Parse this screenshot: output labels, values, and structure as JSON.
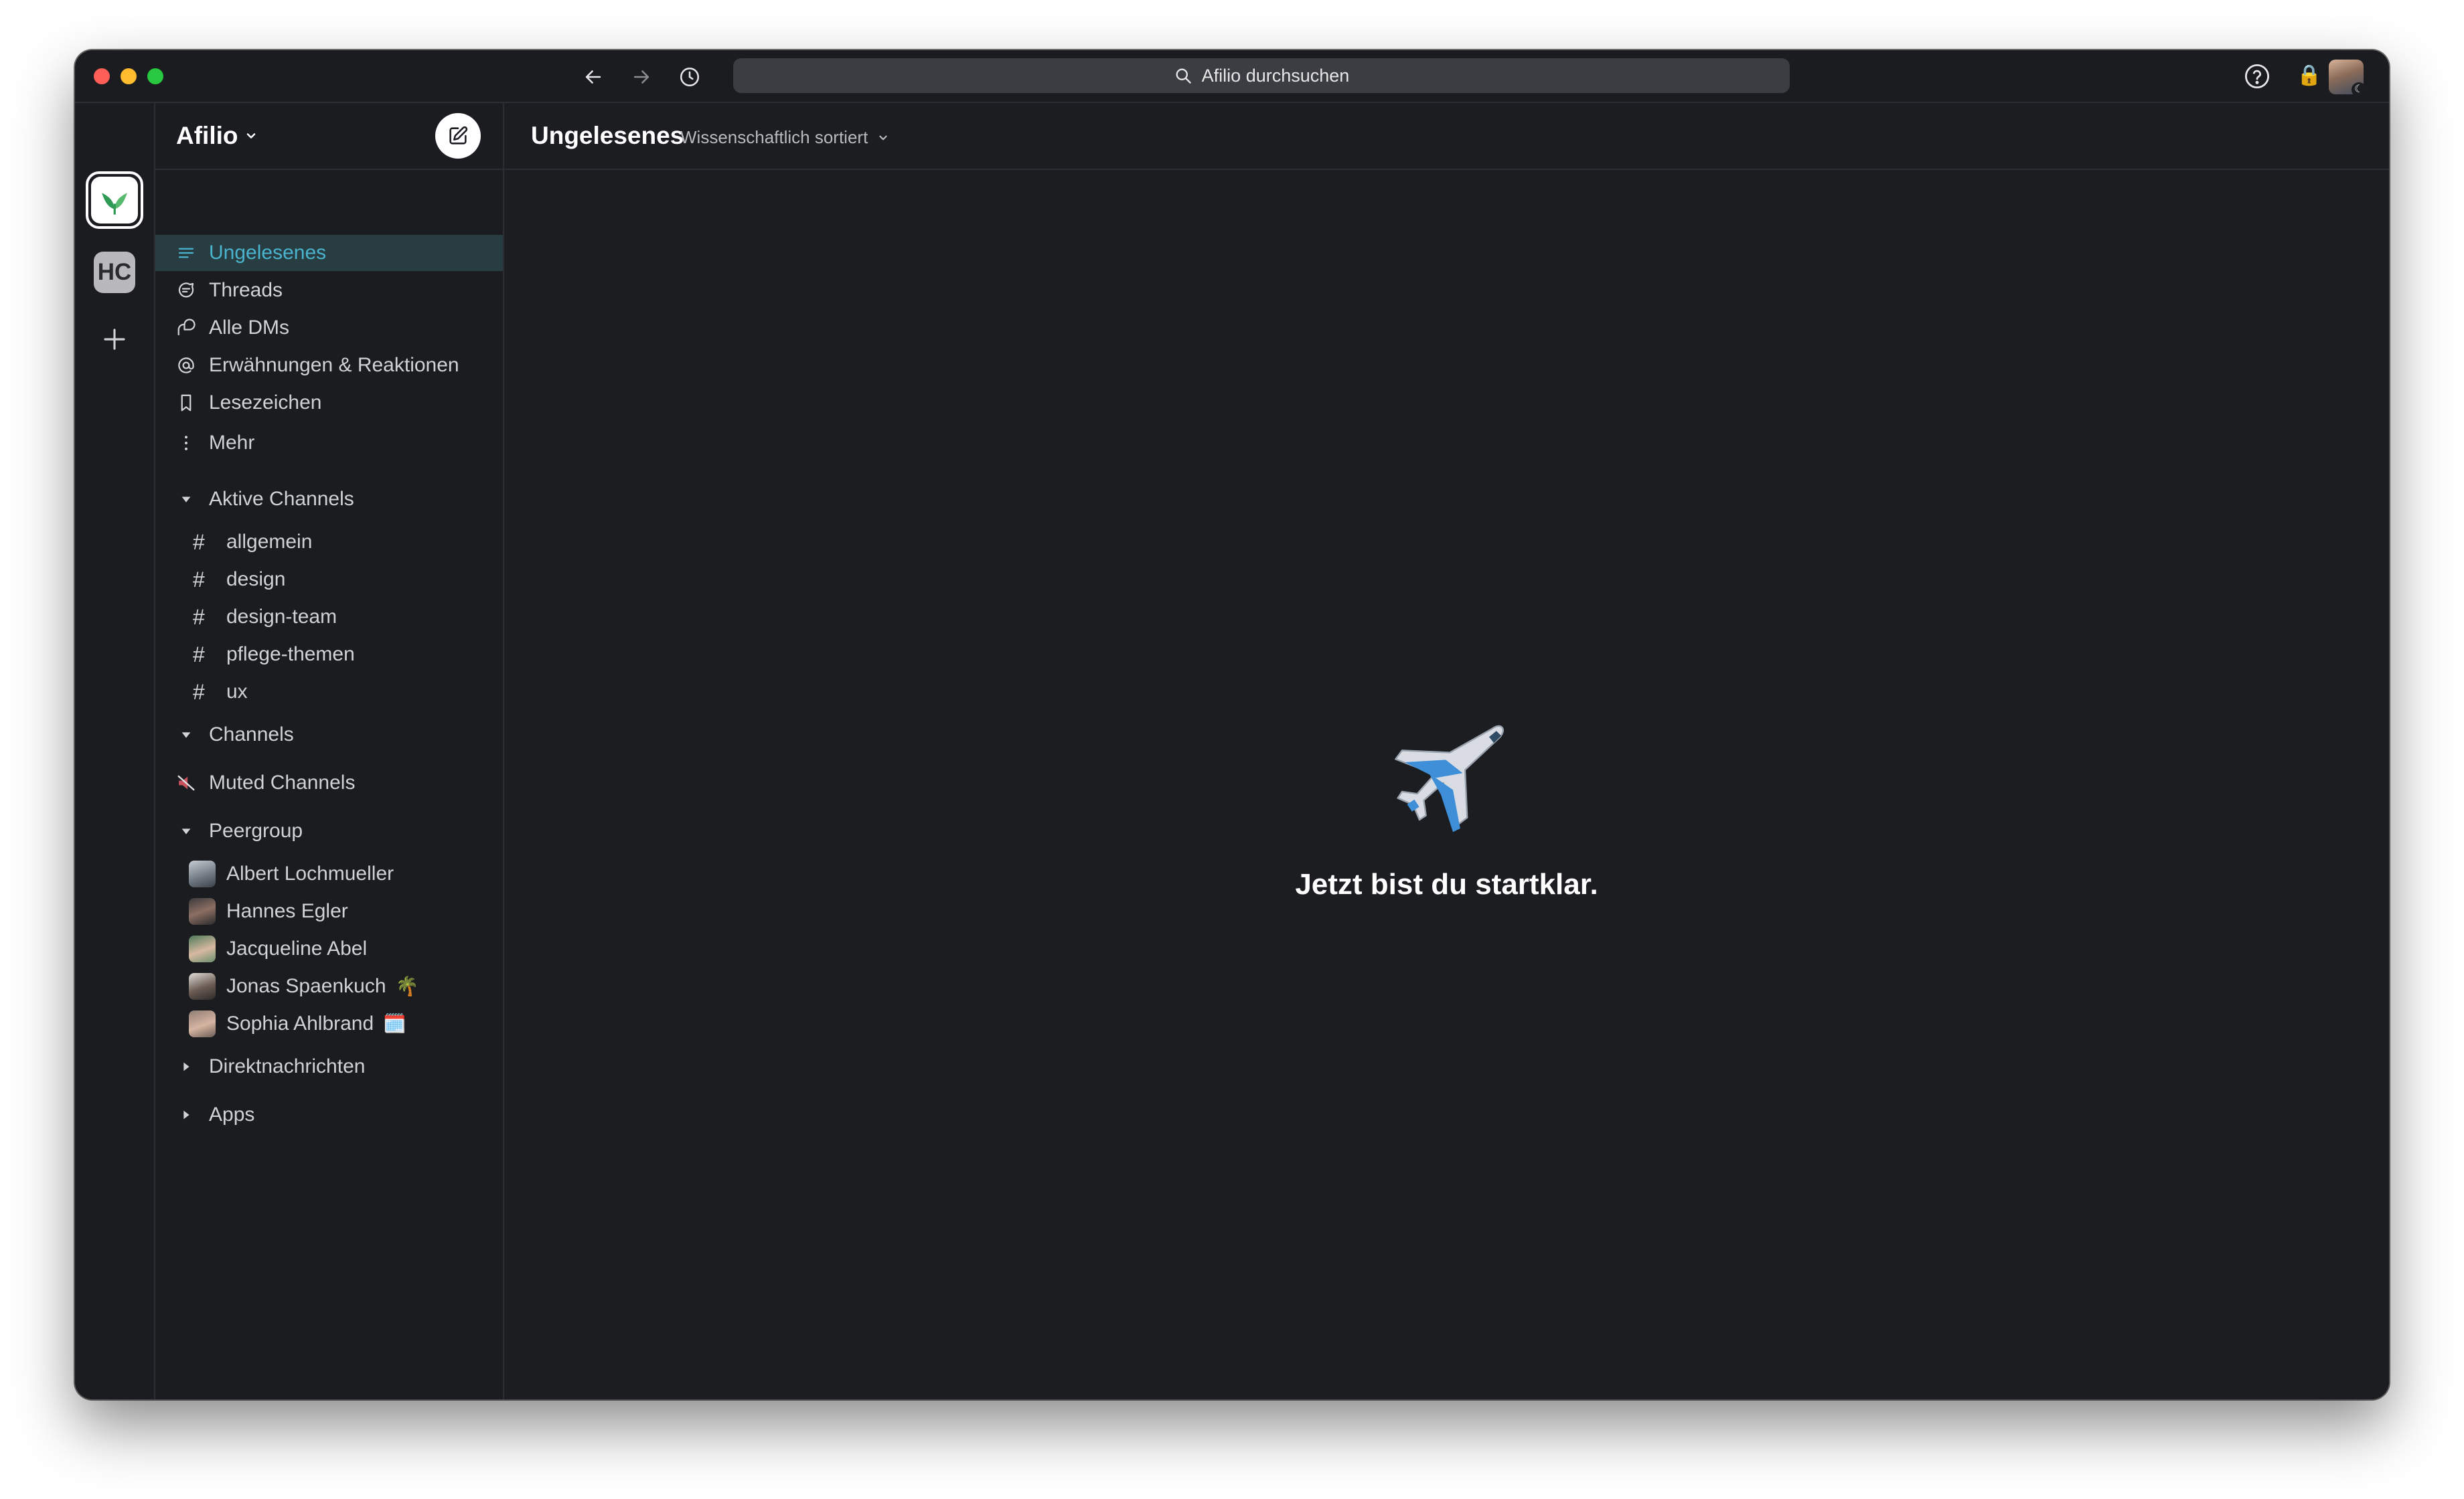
{
  "search": {
    "placeholder": "Afilio durchsuchen"
  },
  "workspaces": {
    "secondary_initials": "HC"
  },
  "sidebar": {
    "workspace_name": "Afilio",
    "nav": [
      {
        "label": "Ungelesenes",
        "icon": "unread-icon"
      },
      {
        "label": "Threads",
        "icon": "threads-icon"
      },
      {
        "label": "Alle DMs",
        "icon": "dms-icon"
      },
      {
        "label": "Erwähnungen & Reaktionen",
        "icon": "at-sign-icon"
      },
      {
        "label": "Lesezeichen",
        "icon": "bookmark-icon"
      },
      {
        "label": "Mehr",
        "icon": "more-icon"
      }
    ],
    "sections": {
      "aktive": "Aktive Channels",
      "channels": "Channels",
      "muted": "Muted Channels",
      "peergroup": "Peergroup",
      "direkt": "Direktnachrichten",
      "apps": "Apps"
    },
    "channels": [
      "allgemein",
      "design",
      "design-team",
      "pflege-themen",
      "ux"
    ],
    "members": [
      {
        "name": "Albert Lochmueller",
        "status_emoji": ""
      },
      {
        "name": "Hannes Egler",
        "status_emoji": ""
      },
      {
        "name": "Jacqueline Abel",
        "status_emoji": ""
      },
      {
        "name": "Jonas Spaenkuch",
        "status_emoji": "🌴"
      },
      {
        "name": "Sophia Ahlbrand",
        "status_emoji": "🗓️"
      }
    ]
  },
  "main": {
    "title": "Ungelesenes",
    "sort_label": "Wissenschaftlich sortiert",
    "empty_message": "Jetzt bist du startklar.",
    "empty_icon": "airplane-icon"
  },
  "colors": {
    "background": "#1b1d21",
    "active_item_bg": "#283d42",
    "active_item_text": "#4ab3ce",
    "text": "#d1d2d3"
  }
}
